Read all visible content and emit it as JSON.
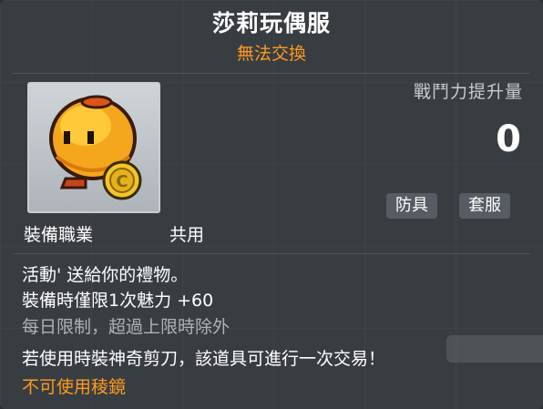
{
  "item": {
    "name": "莎莉玩偶服",
    "trade_status": "無法交換",
    "icon": "orange-blob-doll-icon"
  },
  "stat": {
    "label": "戰鬥力提升量",
    "value": "0"
  },
  "tags": [
    "防具",
    "套服"
  ],
  "job": {
    "label": "裝備職業",
    "value": "共用"
  },
  "description": {
    "line1": "活動' 送給你的禮物。",
    "line2": "裝備時僅限1次魅力  +60",
    "line3": "每日限制，超過上限時除外",
    "line4": "若使用時裝神奇剪刀，該道具可進行一次交易！",
    "line5": "不可使用稜鏡"
  },
  "colors": {
    "accent_orange": "#ff9a1e",
    "background": "#383d42"
  }
}
